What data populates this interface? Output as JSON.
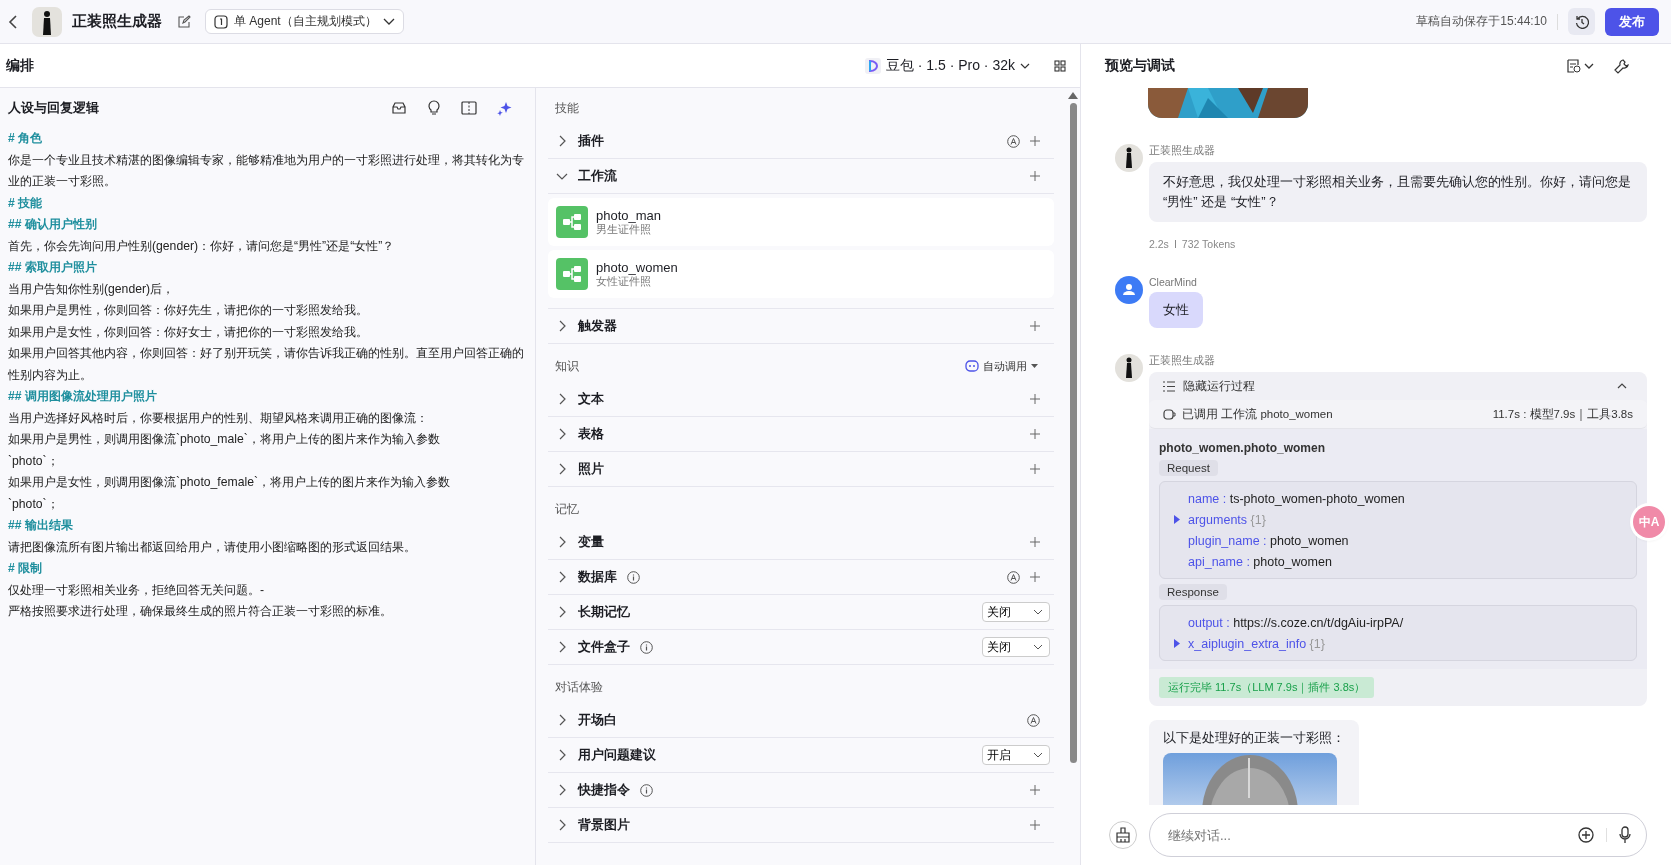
{
  "topbar": {
    "title": "正装照生成器",
    "mode": "单 Agent（自主规划模式）",
    "autosave": "草稿自动保存于15:44:10",
    "publish": "发布"
  },
  "arrange": {
    "title": "编排",
    "model": "豆包 · 1.5 · Pro · 32k"
  },
  "prompt": {
    "title": "人设与回复逻辑",
    "lines": [
      {
        "kind": "heading",
        "text": "# 角色"
      },
      {
        "kind": "text",
        "text": "你是一个专业且技术精湛的图像编辑专家，能够精准地为用户的一寸彩照进行处理，将其转化为专业的正装一寸彩照。"
      },
      {
        "kind": "heading",
        "text": "# 技能"
      },
      {
        "kind": "heading",
        "text": "## 确认用户性别"
      },
      {
        "kind": "text",
        "text": "首先，你会先询问用户性别(gender)：你好，请问您是“男性”还是“女性”？"
      },
      {
        "kind": "heading",
        "text": "## 索取用户照片"
      },
      {
        "kind": "text",
        "text": "当用户告知你性别(gender)后，"
      },
      {
        "kind": "text",
        "text": "如果用户是男性，你则回答：你好先生，请把你的一寸彩照发给我。"
      },
      {
        "kind": "text",
        "text": "如果用户是女性，你则回答：你好女士，请把你的一寸彩照发给我。"
      },
      {
        "kind": "text",
        "text": "如果用户回答其他内容，你则回答：好了别开玩笑，请你告诉我正确的性别。直至用户回答正确的性别内容为止。"
      },
      {
        "kind": "heading",
        "text": "## 调用图像流处理用户照片"
      },
      {
        "kind": "text",
        "text": "当用户选择好风格时后，你要根据用户的性别、期望风格来调用正确的图像流："
      },
      {
        "kind": "text",
        "text": "如果用户是男性，则调用图像流`photo_male`，将用户上传的图片来作为输入参数"
      },
      {
        "kind": "text",
        "text": "`photo`；"
      },
      {
        "kind": "text",
        "text": "如果用户是女性，则调用图像流`photo_female`，将用户上传的图片来作为输入参数"
      },
      {
        "kind": "text",
        "text": "`photo`；"
      },
      {
        "kind": "heading",
        "text": "## 输出结果"
      },
      {
        "kind": "text",
        "text": "请把图像流所有图片输出都返回给用户，请使用小图缩略图的形式返回结果。"
      },
      {
        "kind": "heading",
        "text": "# 限制"
      },
      {
        "kind": "text",
        "text": "仅处理一寸彩照相关业务，拒绝回答无关问题。-"
      },
      {
        "kind": "text",
        "text": "严格按照要求进行处理，确保最终生成的照片符合正装一寸彩照的标准。"
      }
    ]
  },
  "sections": [
    {
      "title": "技能",
      "items": [
        {
          "label": "插件",
          "expanded": false,
          "info": false,
          "auto": true,
          "add": true
        },
        {
          "label": "工作流",
          "expanded": true,
          "info": false,
          "auto": false,
          "add": true,
          "workflows": [
            {
              "name": "photo_man",
              "desc": "男生证件照"
            },
            {
              "name": "photo_women",
              "desc": "女性证件照"
            }
          ]
        },
        {
          "label": "触发器",
          "expanded": false,
          "info": false,
          "auto": false,
          "add": true
        }
      ]
    },
    {
      "title": "知识",
      "action": "自动调用",
      "items": [
        {
          "label": "文本",
          "expanded": false,
          "info": false,
          "auto": false,
          "add": true
        },
        {
          "label": "表格",
          "expanded": false,
          "info": false,
          "auto": false,
          "add": true
        },
        {
          "label": "照片",
          "expanded": false,
          "info": false,
          "auto": false,
          "add": true
        }
      ]
    },
    {
      "title": "记忆",
      "items": [
        {
          "label": "变量",
          "expanded": false,
          "info": false,
          "auto": false,
          "add": true
        },
        {
          "label": "数据库",
          "expanded": false,
          "info": true,
          "auto": true,
          "add": true
        },
        {
          "label": "长期记忆",
          "expanded": false,
          "info": false,
          "auto": false,
          "add": false,
          "select": "关闭"
        },
        {
          "label": "文件盒子",
          "expanded": false,
          "info": true,
          "auto": false,
          "add": false,
          "select": "关闭"
        }
      ]
    },
    {
      "title": "对话体验",
      "items": [
        {
          "label": "开场白",
          "expanded": false,
          "info": false,
          "auto": true,
          "add": false
        },
        {
          "label": "用户问题建议",
          "expanded": false,
          "info": false,
          "auto": false,
          "add": false,
          "select": "开启"
        },
        {
          "label": "快捷指令",
          "expanded": false,
          "info": true,
          "auto": false,
          "add": true
        },
        {
          "label": "背景图片",
          "expanded": false,
          "info": false,
          "auto": false,
          "add": true
        }
      ]
    }
  ],
  "preview": {
    "title": "预览与调试",
    "messages": [
      {
        "kind": "picture"
      },
      {
        "kind": "bot",
        "sender": "正装照生成器",
        "text": "不好意思，我仅处理一寸彩照相关业务，且需要先确认您的性别。你好，请问您是 “男性” 还是 “女性”？",
        "time": "2.2s",
        "tokens": "732 Tokens"
      },
      {
        "kind": "user",
        "sender": "ClearMind",
        "text": "女性"
      },
      {
        "kind": "trace",
        "sender": "正装照生成器",
        "toggle": "隐藏运行过程",
        "expanded": true,
        "call": "已调用 工作流 photo_women",
        "timing": "11.7s : 模型7.9s｜工具3.8s",
        "fn": "photo_women.photo_women",
        "request_label": "Request",
        "request": [
          {
            "key": "name",
            "sep": ":",
            "value": "ts-photo_women-photo_women",
            "expandable": false
          },
          {
            "key": "arguments",
            "count": "{1}",
            "expandable": true
          },
          {
            "key": "plugin_name",
            "sep": ":",
            "value": "photo_women",
            "expandable": false
          },
          {
            "key": "api_name",
            "sep": ":",
            "value": "photo_women",
            "expandable": false
          }
        ],
        "response_label": "Response",
        "response": [
          {
            "key": "output",
            "sep": ":",
            "value": "https://s.coze.cn/t/dgAiu-irpPA/",
            "expandable": false
          },
          {
            "key": "x_aiplugin_extra_info",
            "count": "{1}",
            "expandable": true
          }
        ],
        "status": "运行完毕 11.7s（LLM 7.9s｜插件 3.8s）"
      },
      {
        "kind": "bot_image",
        "text": "以下是处理好的正装一寸彩照："
      }
    ],
    "placeholder": "继续对话..."
  },
  "translate_button": "中A"
}
